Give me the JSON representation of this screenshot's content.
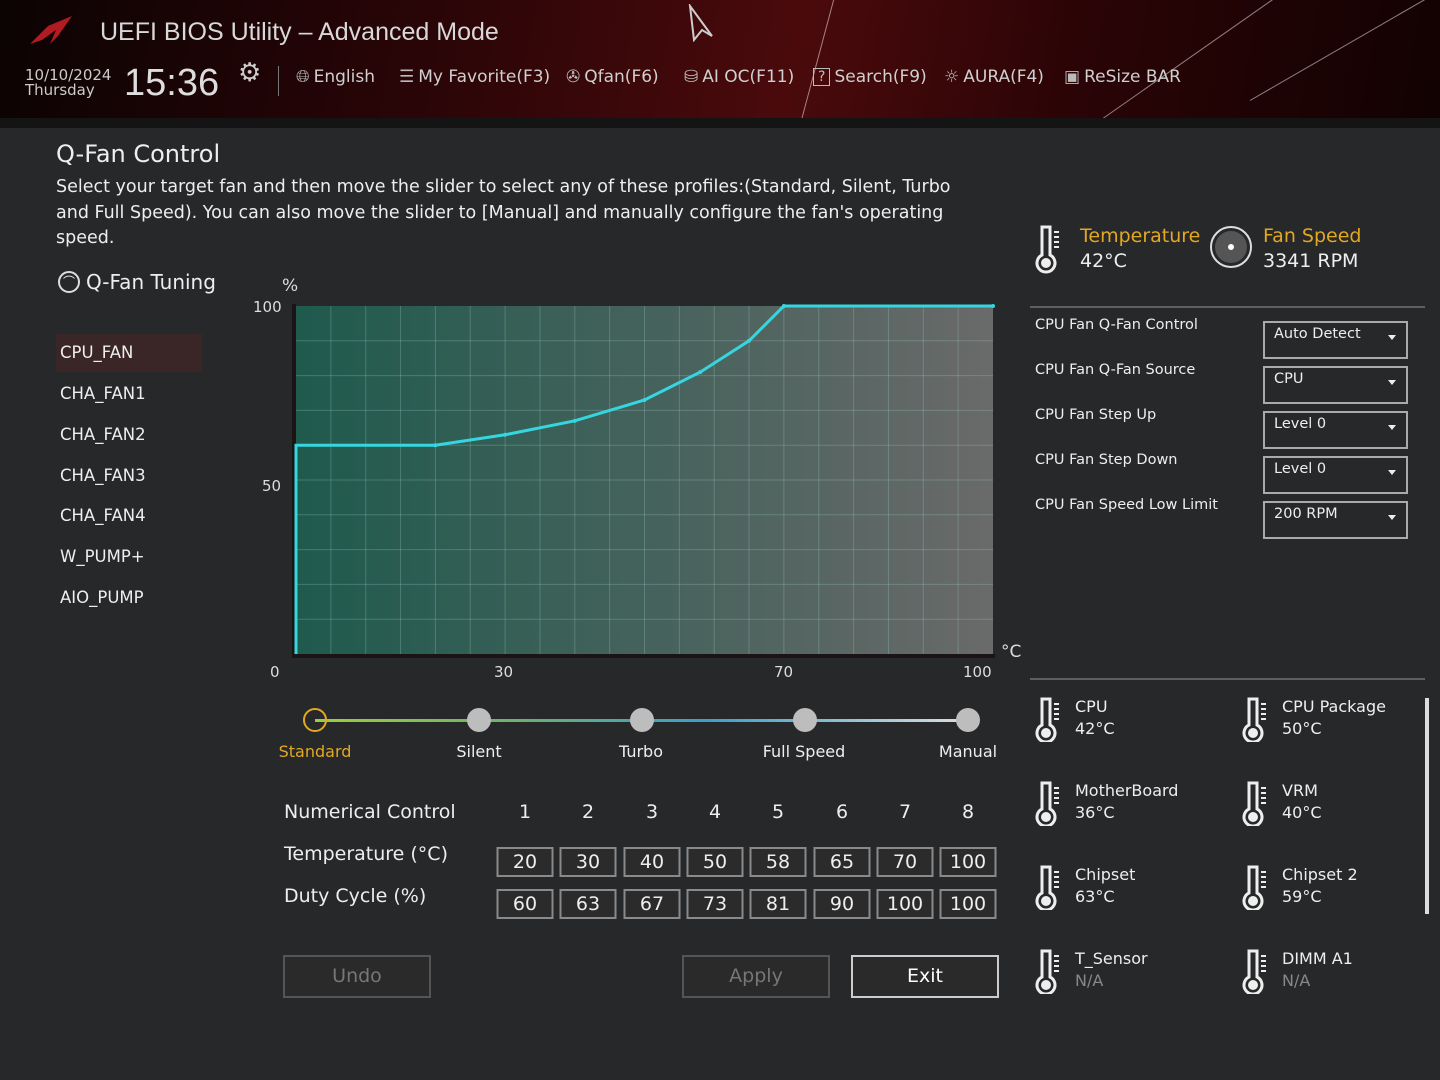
{
  "header": {
    "title": "UEFI BIOS Utility – Advanced Mode",
    "date": "10/10/2024",
    "day": "Thursday",
    "time": "15:36",
    "toolbar": [
      {
        "icon": "globe-icon",
        "label": "English"
      },
      {
        "icon": "favorite-list-icon",
        "label": "My Favorite(F3)"
      },
      {
        "icon": "fan-icon",
        "label": "Qfan(F6)"
      },
      {
        "icon": "ai-chip-icon",
        "label": "AI OC(F11)"
      },
      {
        "icon": "help-search-icon",
        "label": "Search(F9)"
      },
      {
        "icon": "aura-light-icon",
        "label": "AURA(F4)"
      },
      {
        "icon": "gpu-card-icon",
        "label": "ReSize BAR"
      }
    ]
  },
  "page": {
    "title": "Q-Fan Control",
    "description": "Select your target fan and then move the slider to select any of these profiles:(Standard, Silent, Turbo and Full Speed). You can also move the slider to [Manual] and manually configure the fan's operating speed.",
    "tuning_label": "Q-Fan Tuning"
  },
  "fans": [
    {
      "label": "CPU_FAN",
      "selected": true
    },
    {
      "label": "CHA_FAN1"
    },
    {
      "label": "CHA_FAN2"
    },
    {
      "label": "CHA_FAN3"
    },
    {
      "label": "CHA_FAN4"
    },
    {
      "label": "W_PUMP+"
    },
    {
      "label": "AIO_PUMP"
    }
  ],
  "chart_data": {
    "type": "line",
    "xlabel": "°C",
    "ylabel": "%",
    "xlim": [
      0,
      100
    ],
    "ylim": [
      0,
      100
    ],
    "x_ticks": [
      "0",
      "30",
      "70",
      "100"
    ],
    "y_ticks": [
      "100",
      "50"
    ],
    "grid": true,
    "series": [
      {
        "name": "CPU_FAN curve",
        "color": "#35d6e0",
        "x": [
          0,
          0,
          20,
          30,
          40,
          50,
          58,
          65,
          70,
          100
        ],
        "y": [
          0,
          60,
          60,
          63,
          67,
          73,
          81,
          90,
          100,
          100
        ]
      }
    ]
  },
  "profiles": {
    "options": [
      "Standard",
      "Silent",
      "Turbo",
      "Full Speed",
      "Manual"
    ],
    "selected": "Standard"
  },
  "numerical": {
    "label": "Numerical Control",
    "points": [
      "1",
      "2",
      "3",
      "4",
      "5",
      "6",
      "7",
      "8"
    ],
    "temp_label": "Temperature (°C)",
    "duty_label": "Duty Cycle (%)",
    "temps": [
      "20",
      "30",
      "40",
      "50",
      "58",
      "65",
      "70",
      "100"
    ],
    "duties": [
      "60",
      "63",
      "67",
      "73",
      "81",
      "90",
      "100",
      "100"
    ]
  },
  "buttons": {
    "undo": "Undo",
    "apply": "Apply",
    "exit": "Exit"
  },
  "status": {
    "temp_label": "Temperature",
    "temp_value": "42°C",
    "fan_label": "Fan Speed",
    "fan_value": "3341 RPM"
  },
  "settings": [
    {
      "label": "CPU Fan Q-Fan Control",
      "value": "Auto Detect"
    },
    {
      "label": "CPU Fan Q-Fan Source",
      "value": "CPU"
    },
    {
      "label": "CPU Fan Step Up",
      "value": "Level 0"
    },
    {
      "label": "CPU Fan Step Down",
      "value": "Level 0"
    },
    {
      "label": "CPU Fan Speed Low Limit",
      "value": "200 RPM"
    }
  ],
  "sensors": [
    {
      "name": "CPU",
      "value": "42°C"
    },
    {
      "name": "CPU Package",
      "value": "50°C"
    },
    {
      "name": "MotherBoard",
      "value": "36°C"
    },
    {
      "name": "VRM",
      "value": "40°C"
    },
    {
      "name": "Chipset",
      "value": "63°C"
    },
    {
      "name": "Chipset 2",
      "value": "59°C"
    },
    {
      "name": "T_Sensor",
      "value": "N/A"
    },
    {
      "name": "DIMM A1",
      "value": "N/A"
    }
  ],
  "colors": {
    "accent": "#e3a823",
    "curve": "#35d6e0"
  }
}
